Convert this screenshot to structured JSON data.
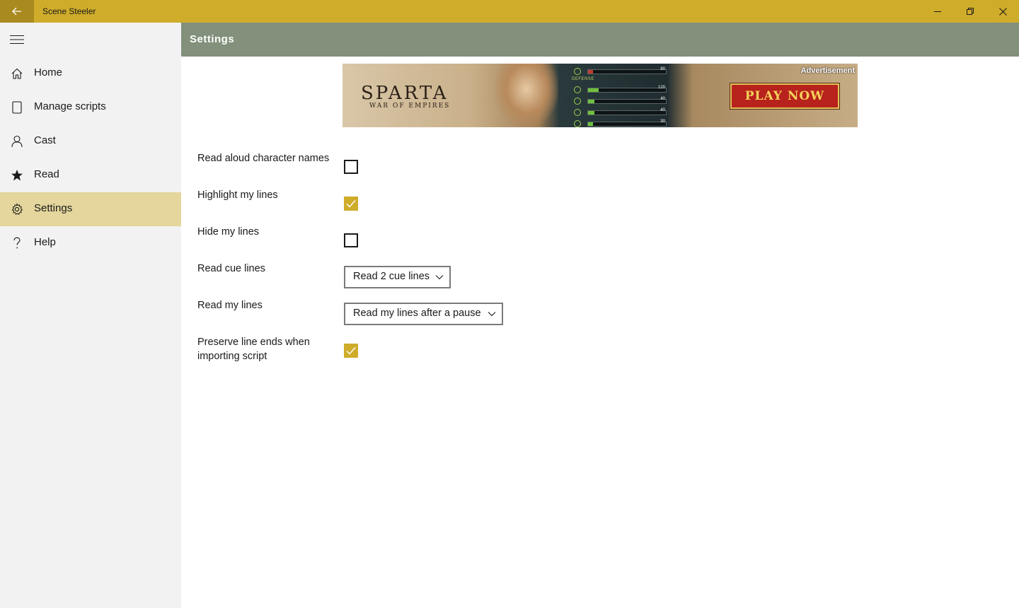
{
  "titlebar": {
    "title": "Scene Steeler",
    "icons": {
      "back": "back-arrow-icon",
      "minimize": "minimize-icon",
      "restore": "restore-icon",
      "close": "close-icon"
    },
    "colors": {
      "bar": "#cfac2a",
      "back_bg": "#a88a1e"
    }
  },
  "sidebar": {
    "menu_icon": "hamburger-icon",
    "items": [
      {
        "label": "Home",
        "icon": "home-icon",
        "active": false
      },
      {
        "label": "Manage scripts",
        "icon": "document-icon",
        "active": false
      },
      {
        "label": "Cast",
        "icon": "person-icon",
        "active": false
      },
      {
        "label": "Read",
        "icon": "star-icon",
        "active": false
      },
      {
        "label": "Settings",
        "icon": "gear-icon",
        "active": true
      },
      {
        "label": "Help",
        "icon": "question-icon",
        "active": false
      }
    ],
    "colors": {
      "background": "#f2f2f2",
      "active": "#e4d69c"
    }
  },
  "header": {
    "title": "Settings",
    "color": "#82907c"
  },
  "ad": {
    "label": "Advertisement",
    "brand": "SPARTA",
    "subtitle": "WAR OF EMPIRES",
    "cta": "PLAY NOW",
    "stats_heading": "DEFENSE",
    "stats": [
      "80",
      "120",
      "40",
      "40",
      "30"
    ]
  },
  "settings": {
    "read_aloud_names": {
      "label": "Read aloud character names",
      "checked": false
    },
    "highlight_lines": {
      "label": "Highlight my lines",
      "checked": true
    },
    "hide_lines": {
      "label": "Hide my lines",
      "checked": false
    },
    "cue_lines": {
      "label": "Read cue lines",
      "value": "Read 2 cue lines"
    },
    "my_lines": {
      "label": "Read my lines",
      "value": "Read my lines after a pause"
    },
    "preserve_line_ends": {
      "label_line1": "Preserve line ends when",
      "label_line2": "importing script",
      "checked": true
    },
    "accent_color": "#cfac2a"
  }
}
